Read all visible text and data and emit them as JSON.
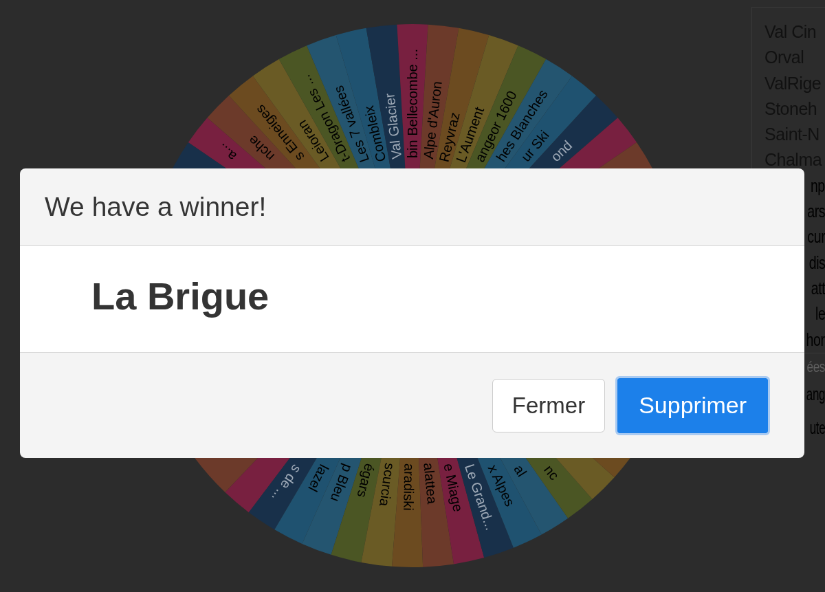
{
  "wheel": {
    "top_segments": [
      {
        "color": "#18304a"
      },
      {
        "label": "a...",
        "color": "#782040"
      },
      {
        "label": "nche",
        "color": "#6c3a2a"
      },
      {
        "label": "s Enneiges",
        "color": "#6c4b20"
      },
      {
        "label": "Leioran",
        "color": "#6a5b25"
      },
      {
        "label": "t-Dragon Les ...",
        "color": "#4b5624"
      },
      {
        "label": "Les 7 vallées",
        "color": "#245570"
      },
      {
        "label": "Combleix",
        "color": "#1f5270"
      },
      {
        "label": "Val Glacier",
        "color": "#18304a"
      },
      {
        "label": "bin Bellecombe ...",
        "color": "#782040"
      },
      {
        "label": "Alpe d'Auron",
        "color": "#6c3a2a"
      },
      {
        "label": "Reyvraz",
        "color": "#6c4b20"
      },
      {
        "label": "L'Aument",
        "color": "#6a5b25"
      },
      {
        "label": "angeor 1600",
        "color": "#4b5624"
      },
      {
        "label": "hes Blanches",
        "color": "#245570"
      },
      {
        "label": "ur Ski",
        "color": "#1f5270"
      },
      {
        "label": "ond",
        "color": "#18304a"
      },
      {
        "color": "#782040"
      },
      {
        "color": "#6c3a2a"
      }
    ],
    "bottom_segments": [
      {
        "color": "#6c3a2a"
      },
      {
        "color": "#782040"
      },
      {
        "label": "s de ...",
        "color": "#18304a"
      },
      {
        "label": "lazel",
        "color": "#1f5270"
      },
      {
        "label": "p Bleu",
        "color": "#245570"
      },
      {
        "label": "égars",
        "color": "#4b5624"
      },
      {
        "label": "scurcia",
        "color": "#6a5b25"
      },
      {
        "label": "aradiski",
        "color": "#6c4b20"
      },
      {
        "label": "alattea",
        "color": "#6c3a2a"
      },
      {
        "label": "e Miage",
        "color": "#782040"
      },
      {
        "label": "Le Grand...",
        "color": "#18304a"
      },
      {
        "label": "x Alpes",
        "color": "#1f5270"
      },
      {
        "label": "al",
        "color": "#245570"
      },
      {
        "label": "nc",
        "color": "#4b5624"
      },
      {
        "color": "#6a5b25"
      },
      {
        "color": "#6c4b20"
      }
    ]
  },
  "entries_panel": {
    "items": [
      "Val Cin",
      "Orval",
      "ValRige",
      "Stoneh",
      "Saint-N",
      "Chalma"
    ],
    "items_behind_dialog": [
      "np",
      "ars",
      "cur",
      "dis",
      "att",
      "le",
      "hor"
    ]
  },
  "side_texts": [
    {
      "text": "ées",
      "kind": "muted"
    },
    {
      "text": "ang",
      "kind": "small"
    },
    {
      "text": "ute",
      "kind": "small"
    }
  ],
  "dialog": {
    "title": "We have a winner!",
    "winner": "La Brigue",
    "buttons": [
      {
        "label": "Fermer",
        "kind": "secondary",
        "focused": false
      },
      {
        "label": "Supprimer",
        "kind": "primary",
        "focused": true
      }
    ]
  }
}
